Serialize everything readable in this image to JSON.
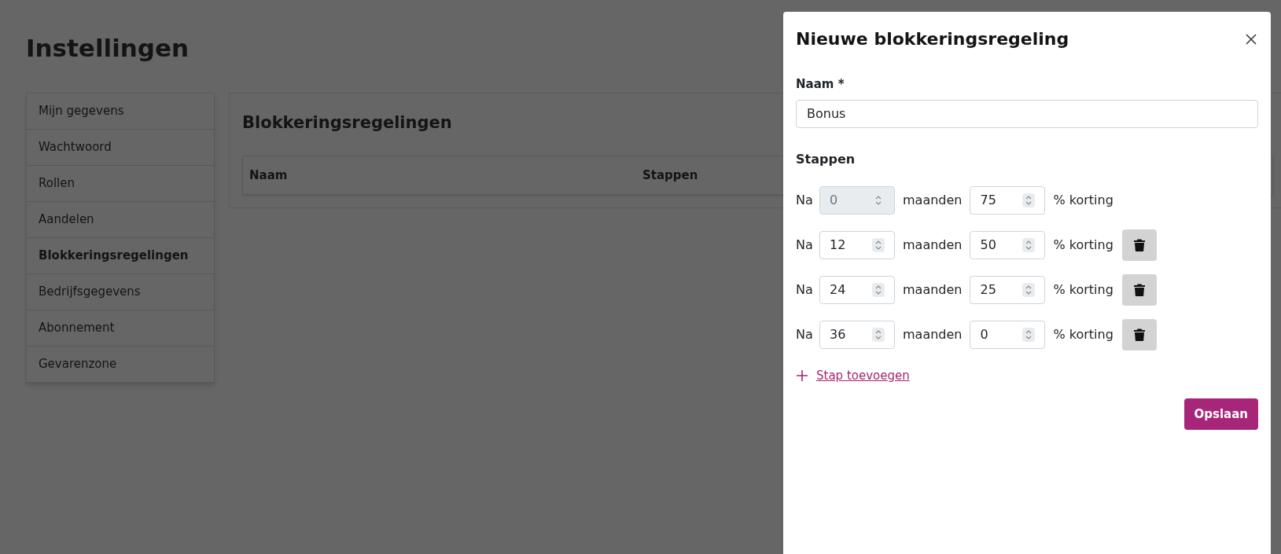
{
  "page": {
    "title": "Instellingen"
  },
  "sidebar": {
    "items": [
      {
        "label": "Mijn gegevens",
        "selected": false
      },
      {
        "label": "Wachtwoord",
        "selected": false
      },
      {
        "label": "Rollen",
        "selected": false
      },
      {
        "label": "Aandelen",
        "selected": false
      },
      {
        "label": "Blokkeringsregelingen",
        "selected": true
      },
      {
        "label": "Bedrijfsgegevens",
        "selected": false
      },
      {
        "label": "Abonnement",
        "selected": false
      },
      {
        "label": "Gevarenzone",
        "selected": false
      }
    ]
  },
  "content": {
    "title": "Blokkeringsregelingen",
    "table": {
      "columns": [
        "Naam",
        "Stappen"
      ]
    }
  },
  "dialog": {
    "title": "Nieuwe blokkeringsregeling",
    "name_label": "Naam *",
    "name_value": "Bonus",
    "steps_title": "Stappen",
    "steps": [
      {
        "prefix": "Na",
        "months": "0",
        "months_disabled": true,
        "months_label": "maanden",
        "discount": "75",
        "discount_label": "% korting",
        "removable": false
      },
      {
        "prefix": "Na",
        "months": "12",
        "months_disabled": false,
        "months_label": "maanden",
        "discount": "50",
        "discount_label": "% korting",
        "removable": true
      },
      {
        "prefix": "Na",
        "months": "24",
        "months_disabled": false,
        "months_label": "maanden",
        "discount": "25",
        "discount_label": "% korting",
        "removable": true
      },
      {
        "prefix": "Na",
        "months": "36",
        "months_disabled": false,
        "months_label": "maanden",
        "discount": "0",
        "discount_label": "% korting",
        "removable": true
      }
    ],
    "add_link": "Stap toevoegen",
    "save_button": "Opslaan"
  }
}
